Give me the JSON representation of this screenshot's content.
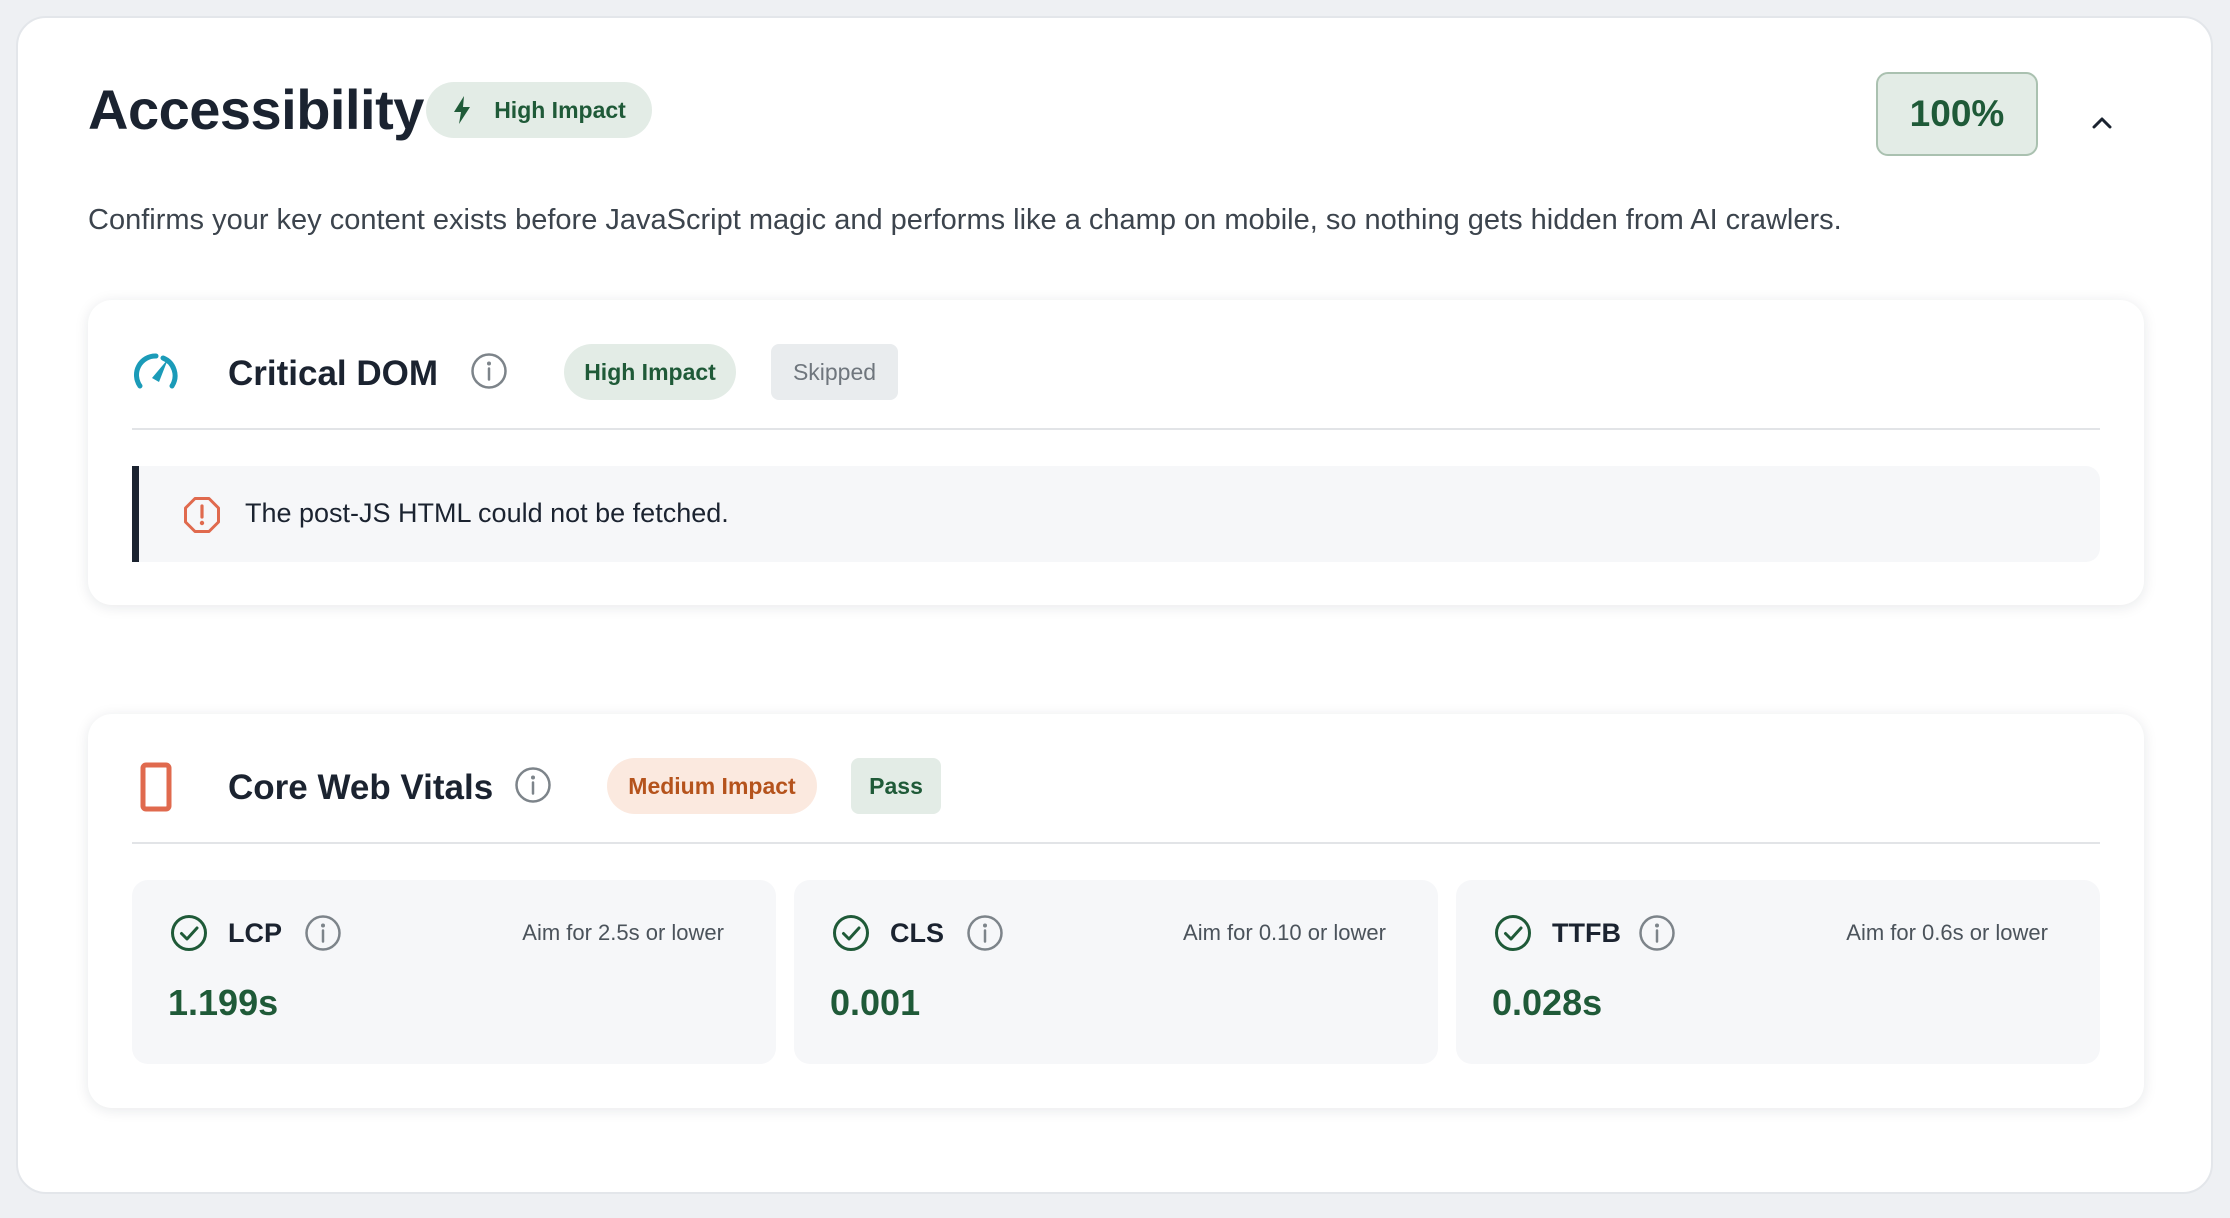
{
  "section": {
    "title": "Accessibility",
    "impact_badge": "High Impact",
    "score": "100%",
    "description": "Confirms your key content exists before JavaScript magic and performs like a champ on mobile, so nothing gets hidden from AI crawlers."
  },
  "critical_dom": {
    "title": "Critical DOM",
    "impact_badge": "High Impact",
    "status_badge": "Skipped",
    "alert_text": "The post-JS HTML could not be fetched."
  },
  "core_web_vitals": {
    "title": "Core Web Vitals",
    "impact_badge": "Medium Impact",
    "status_badge": "Pass",
    "metrics": [
      {
        "name": "LCP",
        "aim": "Aim for 2.5s or lower",
        "value": "1.199s"
      },
      {
        "name": "CLS",
        "aim": "Aim for 0.10 or lower",
        "value": "0.001"
      },
      {
        "name": "TTFB",
        "aim": "Aim for 0.6s or lower",
        "value": "0.028s"
      }
    ]
  },
  "colors": {
    "accent_green": "#1f5a38",
    "badge_green_bg": "#e3ece6",
    "orange": "#e06a4e",
    "teal": "#1b9bb8"
  },
  "icons": {
    "impact": "bolt-icon",
    "critical_dom": "speedometer-icon",
    "core_web_vitals": "mobile-device-icon",
    "alert": "warning-octagon-icon",
    "metric_status": "check-circle-icon",
    "info": "info-icon",
    "collapse": "chevron-up-icon"
  }
}
